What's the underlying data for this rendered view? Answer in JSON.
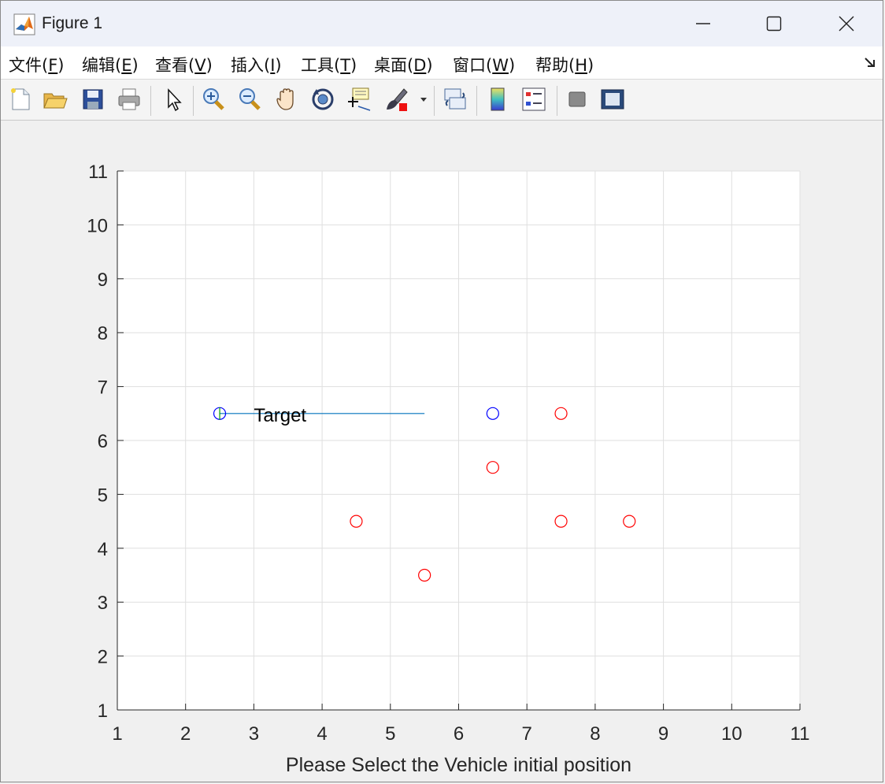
{
  "window": {
    "title": "Figure 1"
  },
  "menu": [
    {
      "text": "文件(",
      "key": "F",
      "end": ")"
    },
    {
      "text": "编辑(",
      "key": "E",
      "end": ")"
    },
    {
      "text": "查看(",
      "key": "V",
      "end": ")"
    },
    {
      "text": "插入(",
      "key": "I",
      "end": ")"
    },
    {
      "text": "工具(",
      "key": "T",
      "end": ")"
    },
    {
      "text": "桌面(",
      "key": "D",
      "end": ")"
    },
    {
      "text": "窗口(",
      "key": "W",
      "end": ")"
    },
    {
      "text": "帮助(",
      "key": "H",
      "end": ")"
    }
  ],
  "toolbar": [
    {
      "name": "new-figure",
      "icon": "new-file-icon"
    },
    {
      "name": "open-file",
      "icon": "folder-open-icon"
    },
    {
      "name": "save-figure",
      "icon": "save-icon"
    },
    {
      "name": "print-figure",
      "icon": "printer-icon"
    },
    {
      "name": "edit-plot",
      "icon": "cursor-arrow-icon"
    },
    {
      "name": "zoom-in",
      "icon": "zoom-in-icon"
    },
    {
      "name": "zoom-out",
      "icon": "zoom-out-icon"
    },
    {
      "name": "pan",
      "icon": "hand-icon"
    },
    {
      "name": "rotate-3d",
      "icon": "rotate-3d-icon"
    },
    {
      "name": "data-cursor",
      "icon": "data-cursor-icon"
    },
    {
      "name": "brush",
      "icon": "brush-icon"
    },
    {
      "name": "brush-dropdown",
      "icon": "dropdown-arrow-icon"
    },
    {
      "name": "link-plot",
      "icon": "link-plot-icon"
    },
    {
      "name": "insert-colorbar",
      "icon": "colorbar-icon"
    },
    {
      "name": "insert-legend",
      "icon": "legend-icon"
    },
    {
      "name": "hide-plot-tools",
      "icon": "hide-tools-icon"
    },
    {
      "name": "show-plot-tools",
      "icon": "show-tools-icon"
    }
  ],
  "chart_data": {
    "type": "scatter",
    "xlabel": "Please Select the Vehicle initial position",
    "ylabel": "",
    "title": "",
    "xlim": [
      1,
      11
    ],
    "ylim": [
      1,
      11
    ],
    "xticks": [
      1,
      2,
      3,
      4,
      5,
      6,
      7,
      8,
      9,
      10,
      11
    ],
    "yticks": [
      1,
      2,
      3,
      4,
      5,
      6,
      7,
      8,
      9,
      10,
      11
    ],
    "grid": true,
    "colors": {
      "target": "#0072bd",
      "blue": "#0000ff",
      "red": "#ff0000",
      "line": "#0072bd",
      "green": "#00a000"
    },
    "series": [
      {
        "marker": "circle",
        "color": "#0000ff",
        "points": [
          [
            2.5,
            6.5
          ],
          [
            6.5,
            6.5
          ]
        ]
      },
      {
        "marker": "circle",
        "color": "#ff0000",
        "points": [
          [
            7.5,
            6.5
          ],
          [
            6.5,
            5.5
          ],
          [
            4.5,
            4.5
          ],
          [
            7.5,
            4.5
          ],
          [
            8.5,
            4.5
          ],
          [
            5.5,
            3.5
          ]
        ]
      },
      {
        "marker": "plus",
        "color": "#00a000",
        "points": [
          [
            2.5,
            6.5
          ]
        ]
      }
    ],
    "lines": [
      {
        "color": "#0072bd",
        "points": [
          [
            2.5,
            6.5
          ],
          [
            5.5,
            6.5
          ]
        ]
      }
    ],
    "annotations": [
      {
        "text": "Target",
        "x": 3.0,
        "y": 6.5
      }
    ]
  }
}
